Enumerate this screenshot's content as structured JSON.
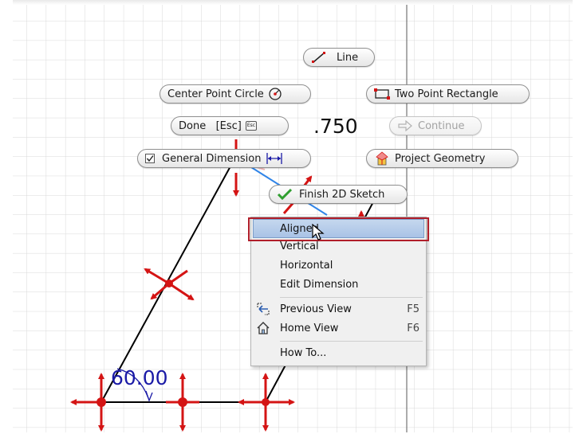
{
  "canvas": {
    "dimension_value": ".750",
    "angle_value": "60.00"
  },
  "marking_menu": {
    "line_label": "Line",
    "center_circle_label": "Center Point Circle",
    "rectangle_label": "Two Point Rectangle",
    "done_label": "Done   [Esc]",
    "done_key": "Esc",
    "continue_label": "Continue",
    "general_dimension_label": "General Dimension",
    "project_geometry_label": "Project Geometry",
    "finish_sketch_label": "Finish 2D Sketch"
  },
  "context_menu": {
    "items": [
      {
        "label": "Aligned",
        "shortcut": ""
      },
      {
        "label": "Vertical",
        "shortcut": ""
      },
      {
        "label": "Horizontal",
        "shortcut": ""
      },
      {
        "label": "Edit Dimension",
        "shortcut": ""
      },
      {
        "label": "Previous View",
        "shortcut": "F5"
      },
      {
        "label": "Home View",
        "shortcut": "F6"
      },
      {
        "label": "How To...",
        "shortcut": ""
      }
    ],
    "selected_index": 0
  },
  "colors": {
    "grid": "#d9d9d9",
    "geometry": "#000000",
    "constraint_arrows": "#d41414",
    "selected_dimension": "#2f84e8",
    "dimension_text": "#1a1aa6",
    "menu_highlight_border": "#b01e2a"
  }
}
